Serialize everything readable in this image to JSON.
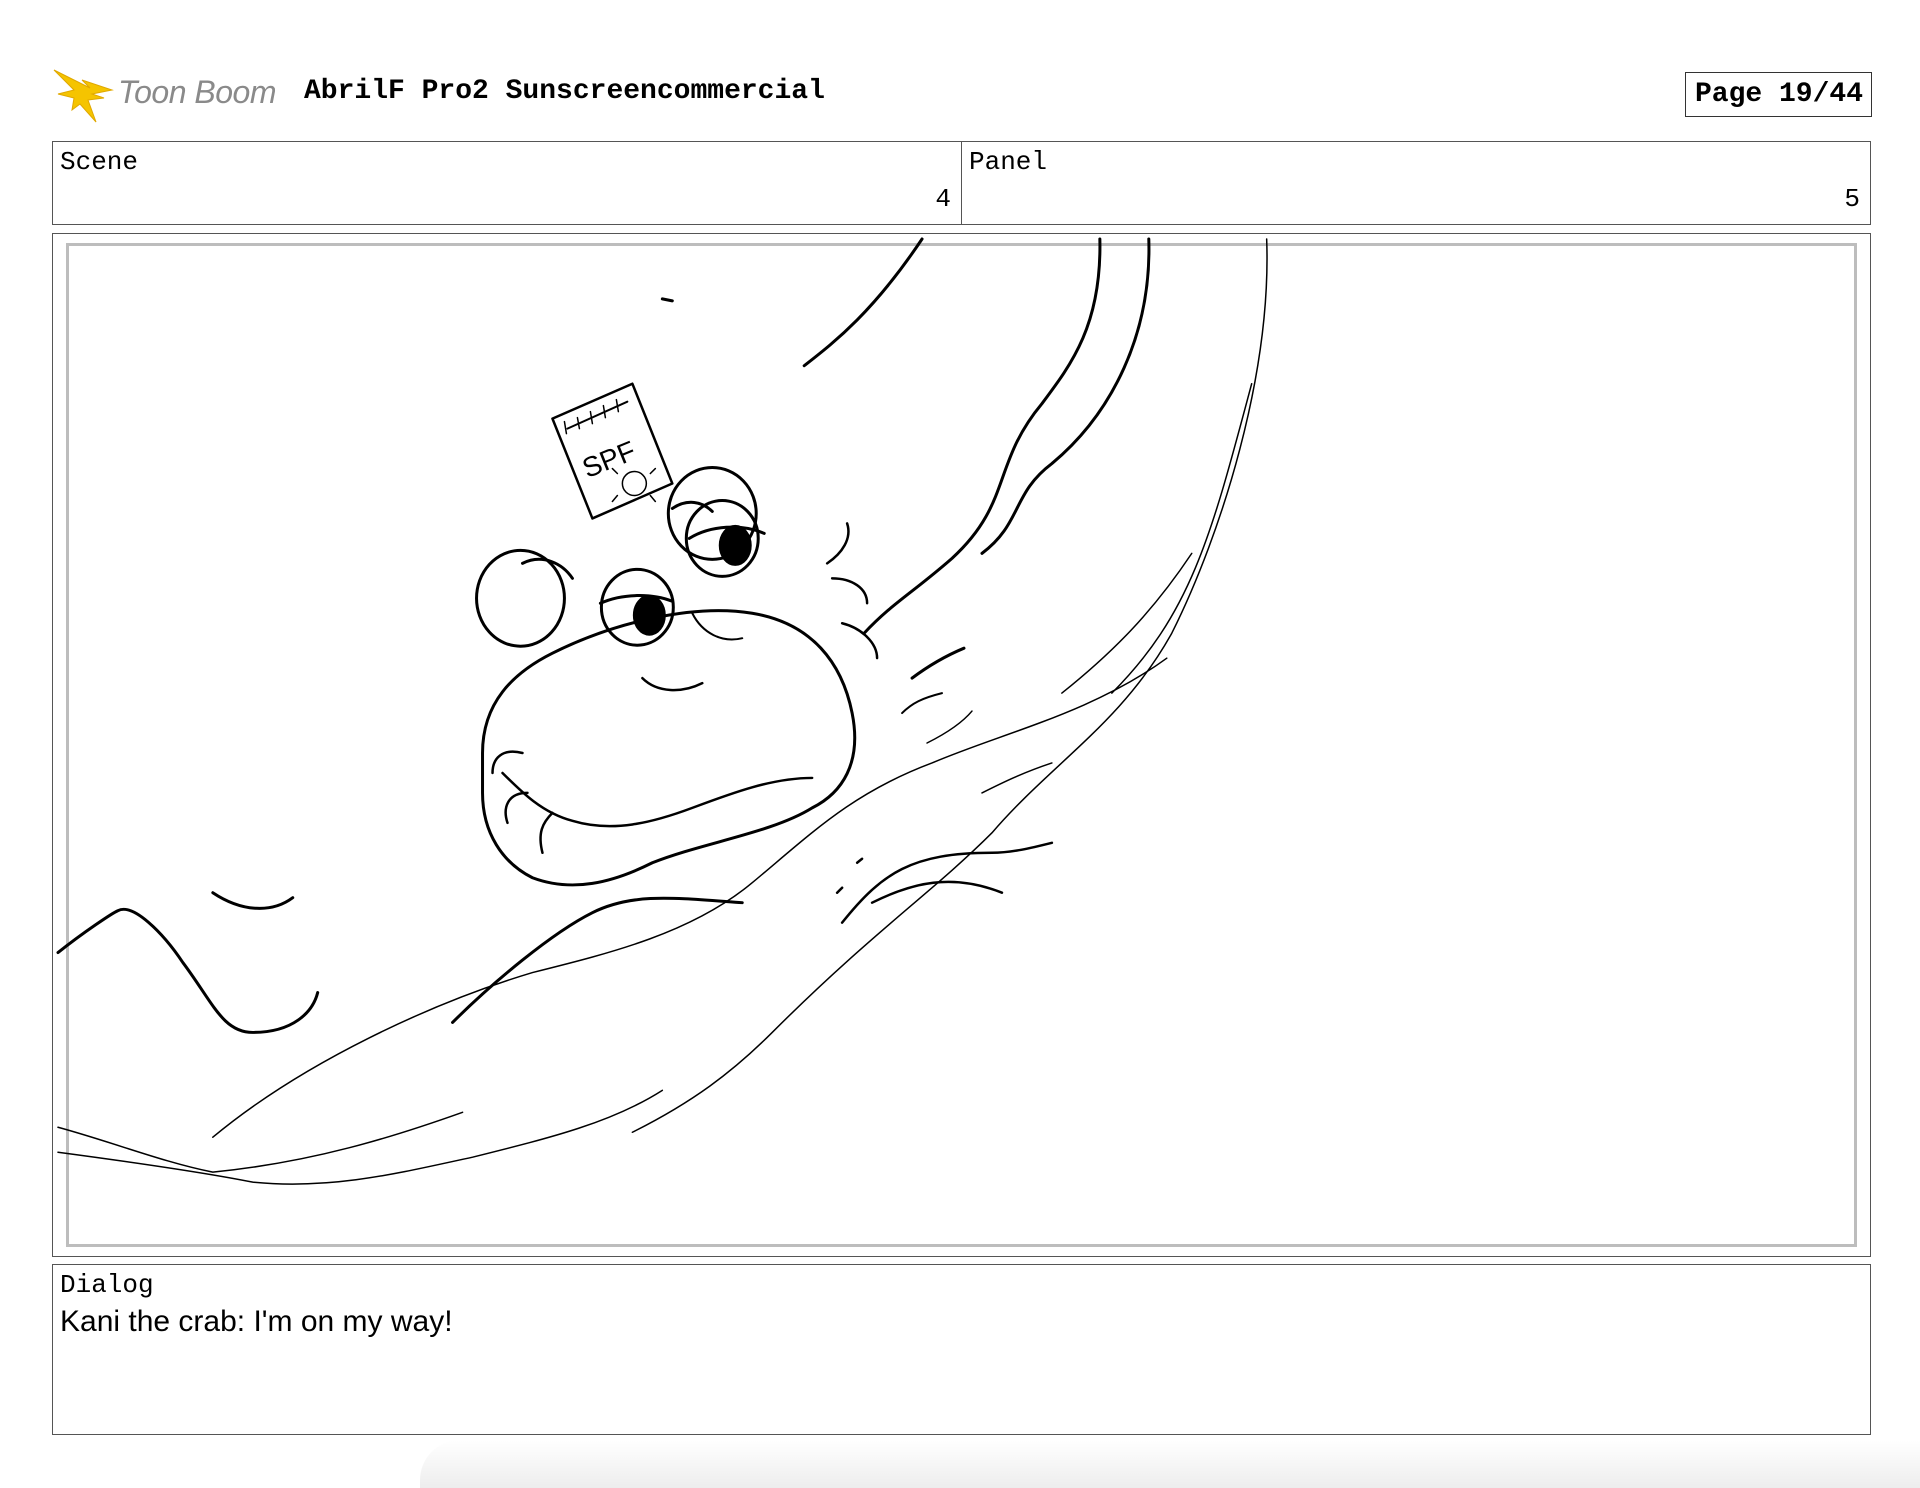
{
  "header": {
    "brand": "Toon Boom",
    "title": "AbrilF Pro2 Sunscreencommercial",
    "page_label": "Page 19/44"
  },
  "scene": {
    "label": "Scene",
    "value": "4"
  },
  "panel": {
    "label": "Panel",
    "value": "5"
  },
  "artwork": {
    "bottle_text": "SPF"
  },
  "dialog": {
    "label": "Dialog",
    "text": "Kani the crab: I'm on my way!"
  },
  "colors": {
    "logo_star": "#f5c400",
    "frame_border": "#555555",
    "inner_border": "#bdbdbd"
  }
}
